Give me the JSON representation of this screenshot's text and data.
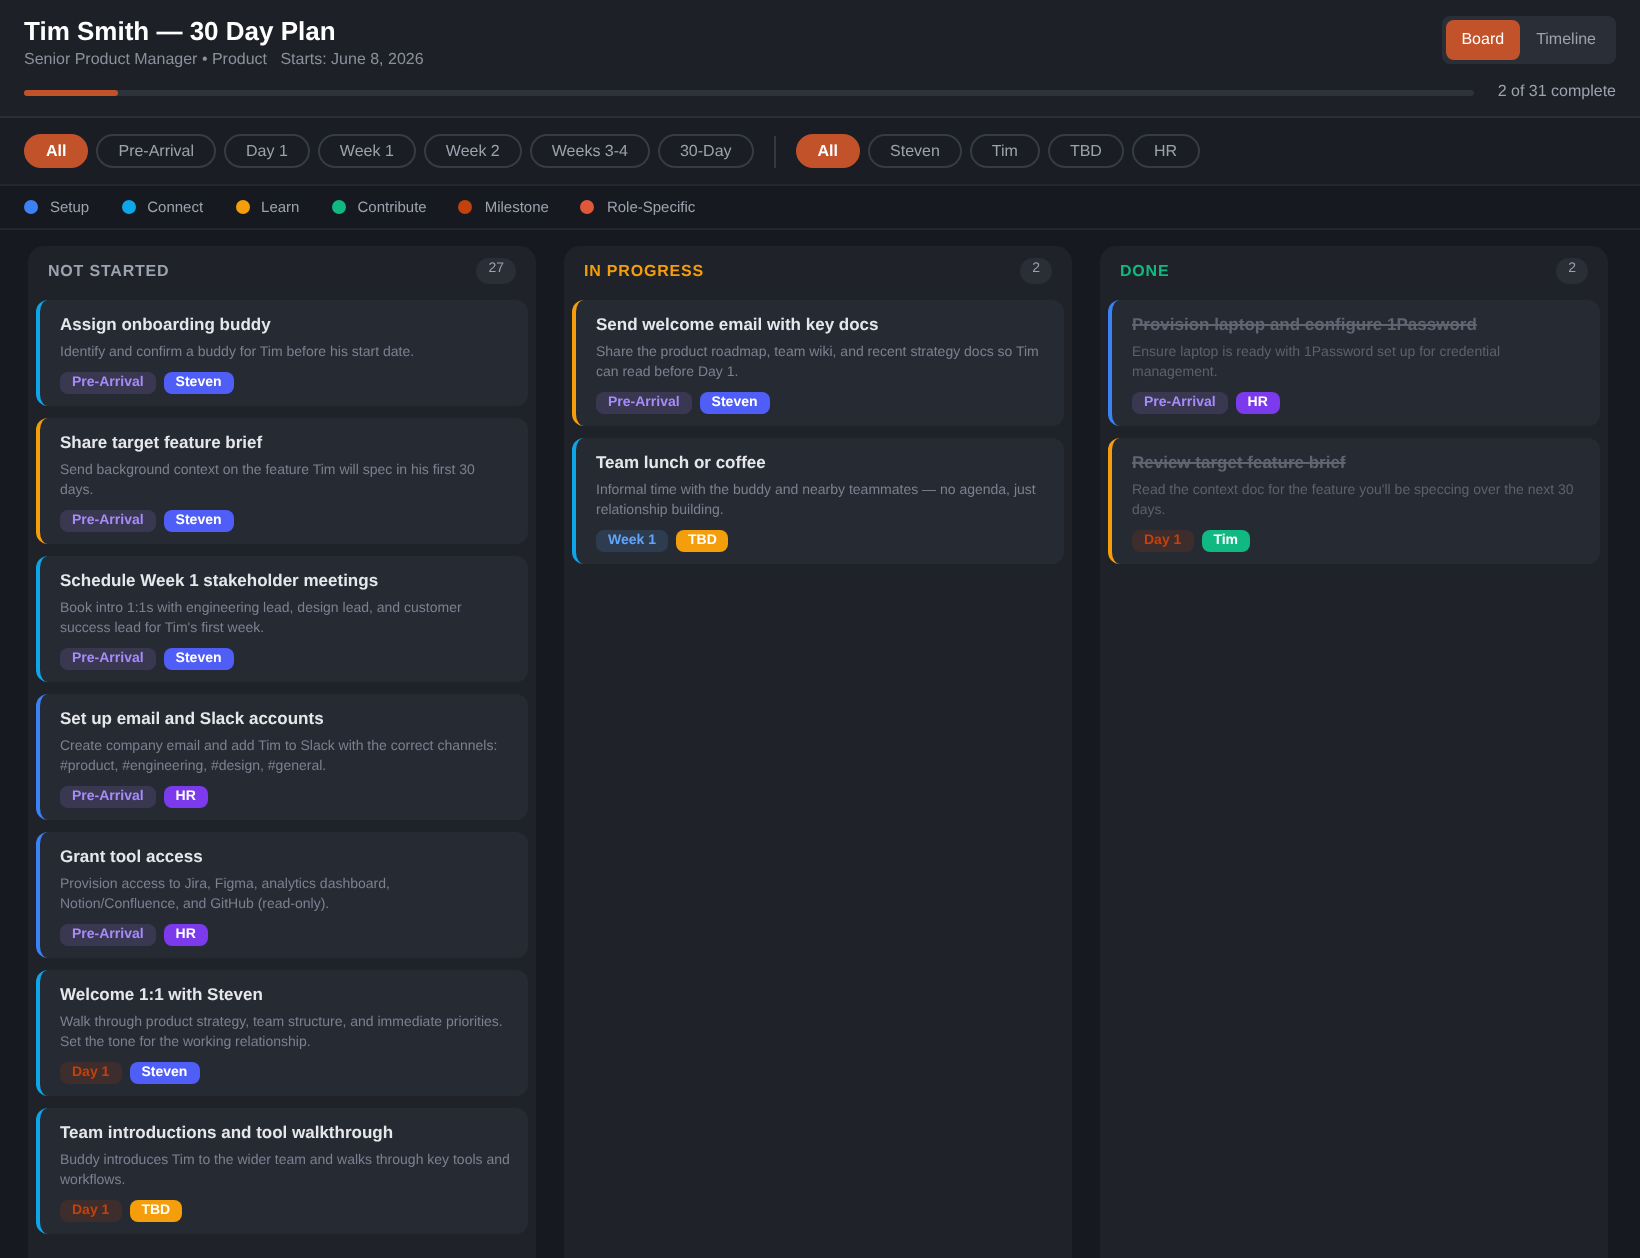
{
  "header": {
    "title": "Tim Smith — 30 Day Plan",
    "subtitle": "Senior Product Manager • Product   Starts: June 8, 2026",
    "progress": {
      "level": 0.065,
      "label": "2 of 31 complete"
    },
    "views": [
      {
        "label": "Board",
        "selected": true
      },
      {
        "label": "Timeline",
        "selected": false
      }
    ]
  },
  "phase_filters": [
    {
      "label": "All",
      "selected": true
    },
    {
      "label": "Pre-Arrival",
      "selected": false
    },
    {
      "label": "Day 1",
      "selected": false
    },
    {
      "label": "Week 1",
      "selected": false
    },
    {
      "label": "Week 2",
      "selected": false
    },
    {
      "label": "Weeks 3-4",
      "selected": false
    },
    {
      "label": "30-Day",
      "selected": false
    }
  ],
  "owner_filters": [
    {
      "label": "All",
      "selected": true
    },
    {
      "label": "Steven",
      "selected": false
    },
    {
      "label": "Tim",
      "selected": false
    },
    {
      "label": "TBD",
      "selected": false
    },
    {
      "label": "HR",
      "selected": false
    }
  ],
  "legend": [
    {
      "label": "Setup",
      "color": "#3b82f6"
    },
    {
      "label": "Connect",
      "color": "#0ea5e9"
    },
    {
      "label": "Learn",
      "color": "#f59e0b"
    },
    {
      "label": "Contribute",
      "color": "#10b981"
    },
    {
      "label": "Milestone",
      "color": "#c2410c"
    },
    {
      "label": "Role-Specific",
      "color": "#e0583a"
    }
  ],
  "columns": [
    {
      "title": "NOT STARTED",
      "kind": "todo",
      "count": "27",
      "cards": [
        {
          "title": "Assign onboarding buddy",
          "description": "Identify and confirm a buddy for Tim before his start date.",
          "color": "#0ea5e9",
          "done": false,
          "tags": [
            {
              "label": "Pre-Arrival",
              "kind": "phase",
              "color": "#a78bfa"
            },
            {
              "label": "Steven",
              "kind": "owner",
              "color": "#4f5ef7"
            }
          ]
        },
        {
          "title": "Share target feature brief",
          "description": "Send background context on the feature Tim will spec in his first 30 days.",
          "color": "#f59e0b",
          "done": false,
          "tags": [
            {
              "label": "Pre-Arrival",
              "kind": "phase",
              "color": "#a78bfa"
            },
            {
              "label": "Steven",
              "kind": "owner",
              "color": "#4f5ef7"
            }
          ]
        },
        {
          "title": "Schedule Week 1 stakeholder meetings",
          "description": "Book intro 1:1s with engineering lead, design lead, and customer success lead for Tim's first week.",
          "color": "#0ea5e9",
          "done": false,
          "tags": [
            {
              "label": "Pre-Arrival",
              "kind": "phase",
              "color": "#a78bfa"
            },
            {
              "label": "Steven",
              "kind": "owner",
              "color": "#4f5ef7"
            }
          ]
        },
        {
          "title": "Set up email and Slack accounts",
          "description": "Create company email and add Tim to Slack with the correct channels: #product, #engineering, #design, #general.",
          "color": "#3b82f6",
          "done": false,
          "tags": [
            {
              "label": "Pre-Arrival",
              "kind": "phase",
              "color": "#a78bfa"
            },
            {
              "label": "HR",
              "kind": "owner",
              "color": "#7c3aed"
            }
          ]
        },
        {
          "title": "Grant tool access",
          "description": "Provision access to Jira, Figma, analytics dashboard, Notion/Confluence, and GitHub (read-only).",
          "color": "#3b82f6",
          "done": false,
          "tags": [
            {
              "label": "Pre-Arrival",
              "kind": "phase",
              "color": "#a78bfa"
            },
            {
              "label": "HR",
              "kind": "owner",
              "color": "#7c3aed"
            }
          ]
        },
        {
          "title": "Welcome 1:1 with Steven",
          "description": "Walk through product strategy, team structure, and immediate priorities. Set the tone for the working relationship.",
          "color": "#0ea5e9",
          "done": false,
          "tags": [
            {
              "label": "Day 1",
              "kind": "phase",
              "color": "#c2410c"
            },
            {
              "label": "Steven",
              "kind": "owner",
              "color": "#4f5ef7"
            }
          ]
        },
        {
          "title": "Team introductions and tool walkthrough",
          "description": "Buddy introduces Tim to the wider team and walks through key tools and workflows.",
          "color": "#0ea5e9",
          "done": false,
          "tags": [
            {
              "label": "Day 1",
              "kind": "phase",
              "color": "#c2410c"
            },
            {
              "label": "TBD",
              "kind": "owner",
              "color": "#f59e0b"
            }
          ]
        }
      ]
    },
    {
      "title": "IN PROGRESS",
      "kind": "doing",
      "count": "2",
      "cards": [
        {
          "title": "Send welcome email with key docs",
          "description": "Share the product roadmap, team wiki, and recent strategy docs so Tim can read before Day 1.",
          "color": "#f59e0b",
          "done": false,
          "tags": [
            {
              "label": "Pre-Arrival",
              "kind": "phase",
              "color": "#a78bfa"
            },
            {
              "label": "Steven",
              "kind": "owner",
              "color": "#4f5ef7"
            }
          ]
        },
        {
          "title": "Team lunch or coffee",
          "description": "Informal time with the buddy and nearby teammates — no agenda, just relationship building.",
          "color": "#0ea5e9",
          "done": false,
          "tags": [
            {
              "label": "Week 1",
              "kind": "phase",
              "color": "#60a5fa"
            },
            {
              "label": "TBD",
              "kind": "owner",
              "color": "#f59e0b"
            }
          ]
        }
      ]
    },
    {
      "title": "DONE",
      "kind": "done",
      "count": "2",
      "cards": [
        {
          "title": "Provision laptop and configure 1Password",
          "description": "Ensure laptop is ready with 1Password set up for credential management.",
          "color": "#3b82f6",
          "done": true,
          "tags": [
            {
              "label": "Pre-Arrival",
              "kind": "phase",
              "color": "#a78bfa"
            },
            {
              "label": "HR",
              "kind": "owner",
              "color": "#7c3aed"
            }
          ]
        },
        {
          "title": "Review target feature brief",
          "description": "Read the context doc for the feature you'll be speccing over the next 30 days.",
          "color": "#f59e0b",
          "done": true,
          "tags": [
            {
              "label": "Day 1",
              "kind": "phase",
              "color": "#c2410c"
            },
            {
              "label": "Tim",
              "kind": "owner",
              "color": "#10b981"
            }
          ]
        }
      ]
    }
  ]
}
